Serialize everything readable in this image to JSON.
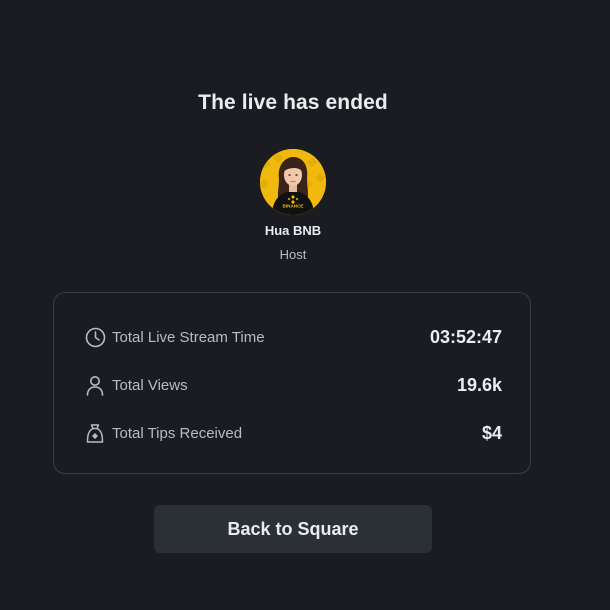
{
  "title": "The live has ended",
  "host": {
    "name": "Hua BNB",
    "role": "Host",
    "avatar_shirt_text": "BINANCE"
  },
  "stats": [
    {
      "icon": "clock-icon",
      "label": "Total Live Stream Time",
      "value": "03:52:47"
    },
    {
      "icon": "user-icon",
      "label": "Total Views",
      "value": "19.6k"
    },
    {
      "icon": "money-bag-icon",
      "label": "Total Tips Received",
      "value": "$4"
    }
  ],
  "back_button": {
    "label": "Back to Square"
  },
  "colors": {
    "background": "#1b1c21",
    "card_border": "#3a3d44",
    "button_bg": "#2b2f36",
    "text_primary": "#eaecef",
    "text_secondary": "#b7bdc6",
    "brand_yellow": "#f0b90b"
  }
}
